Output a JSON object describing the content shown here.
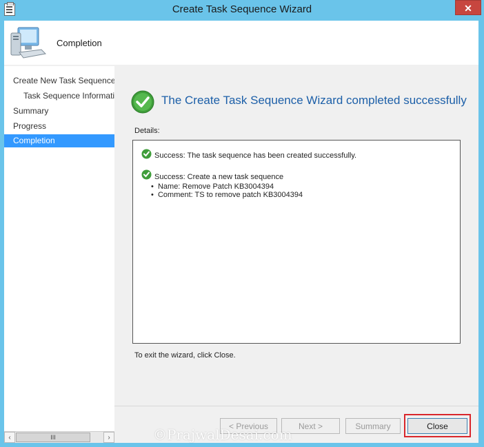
{
  "window": {
    "title": "Create Task Sequence Wizard",
    "close_glyph": "✕"
  },
  "header": {
    "title": "Completion",
    "icon": "computer-icon"
  },
  "nav": {
    "items": [
      {
        "label": "Create New Task Sequence",
        "sub": false,
        "active": false
      },
      {
        "label": "Task Sequence Informati",
        "sub": true,
        "active": false
      },
      {
        "label": "Summary",
        "sub": false,
        "active": false
      },
      {
        "label": "Progress",
        "sub": false,
        "active": false
      },
      {
        "label": "Completion",
        "sub": false,
        "active": true
      }
    ],
    "scroll_thumb_glyph": "III"
  },
  "content": {
    "headline": "The Create Task Sequence Wizard completed successfully",
    "details_label": "Details:",
    "details": [
      {
        "text": "Success: The task sequence has been created successfully."
      },
      {
        "text": "Success: Create a new task sequence"
      }
    ],
    "bullets": [
      "Name: Remove Patch KB3004394",
      "Comment: TS to remove patch KB3004394"
    ],
    "exit_text": "To exit the wizard, click Close."
  },
  "buttons": {
    "previous": "< Previous",
    "next": "Next >",
    "summary": "Summary",
    "close": "Close"
  },
  "watermark": "©PrajwalDesai.com",
  "colors": {
    "accent": "#3399ff",
    "headline": "#1c5fa8",
    "highlight": "#d9262b",
    "frame": "#6ac4ea"
  }
}
